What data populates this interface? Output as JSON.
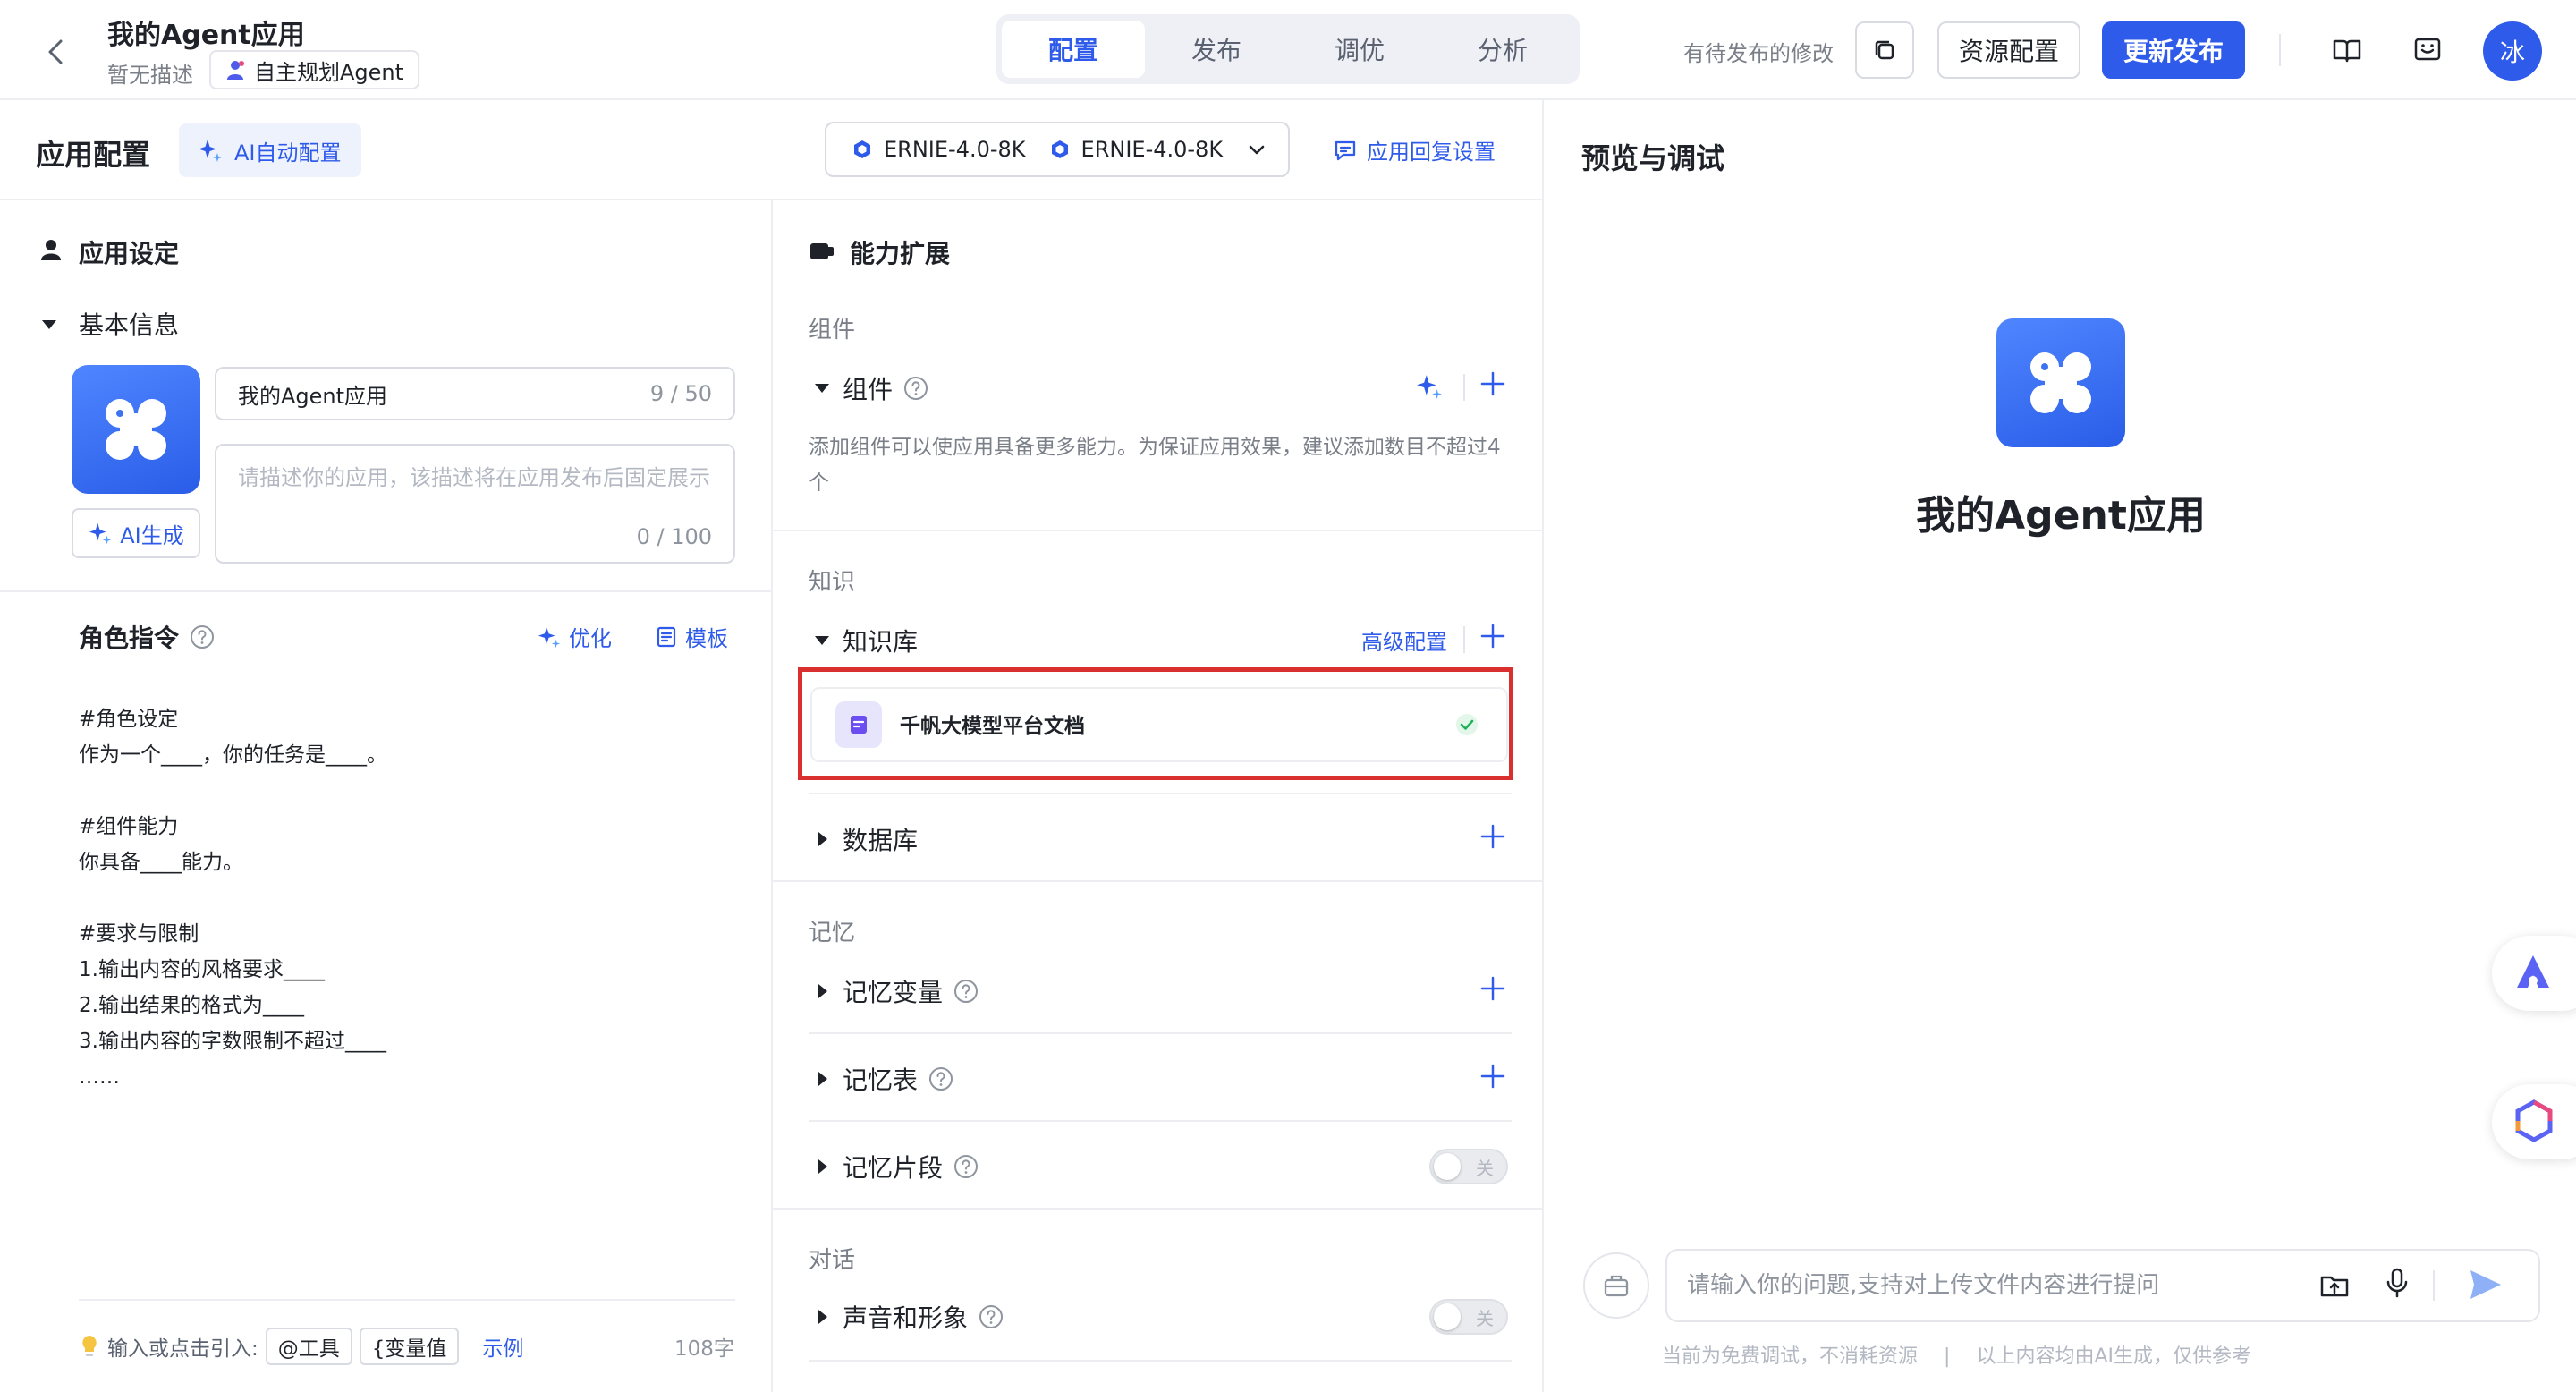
{
  "header": {
    "title": "我的Agent应用",
    "description": "暂无描述",
    "agent_type": "自主规划Agent",
    "tabs": [
      {
        "label": "配置",
        "active": true
      },
      {
        "label": "发布",
        "active": false
      },
      {
        "label": "调优",
        "active": false
      },
      {
        "label": "分析",
        "active": false
      }
    ],
    "pending_changes": "有待发布的修改",
    "resource_button": "资源配置",
    "publish_button": "更新发布",
    "avatar": "冰"
  },
  "config": {
    "title": "应用配置",
    "ai_config": "AI自动配置",
    "models": [
      "ERNIE-4.0-8K",
      "ERNIE-4.0-8K"
    ],
    "reply_settings": "应用回复设置"
  },
  "settings": {
    "title": "应用设定",
    "basic_info": "基本信息",
    "ai_generate": "AI生成",
    "name_value": "我的Agent应用",
    "name_count": "9 / 50",
    "desc_placeholder": "请描述你的应用，该描述将在应用发布后固定展示",
    "desc_count": "0 / 100",
    "role_title": "角色指令",
    "optimize": "优化",
    "template": "模板",
    "prompt_lines": [
      "#角色设定",
      "作为一个____，你的任务是____。",
      "",
      "#组件能力",
      "你具备____能力。",
      "",
      "#要求与限制",
      "1.输出内容的风格要求____",
      "2.输出结果的格式为____",
      "3.输出内容的字数限制不超过____",
      "……"
    ],
    "hint": "输入或点击引入:",
    "chip_tool": "@工具",
    "chip_var": "{变量值",
    "example": "示例",
    "word_count": "108字"
  },
  "extensions": {
    "title": "能力扩展",
    "components_group": "组件",
    "components_title": "组件",
    "components_desc": "添加组件可以使应用具备更多能力。为保证应用效果，建议添加数目不超过4个",
    "knowledge_group": "知识",
    "kb_title": "知识库",
    "advanced_config": "高级配置",
    "kb_item": "千帆大模型平台文档",
    "database_title": "数据库",
    "memory_group": "记忆",
    "memory_variables": "记忆变量",
    "memory_table": "记忆表",
    "memory_fragments": "记忆片段",
    "toggle_off": "关",
    "dialog_group": "对话",
    "voice_avatar": "声音和形象"
  },
  "preview": {
    "title": "预览与调试",
    "app_name": "我的Agent应用",
    "input_placeholder": "请输入你的问题,支持对上传文件内容进行提问",
    "note_left": "当前为免费调试，不消耗资源",
    "note_sep": "|",
    "note_right": "以上内容均由AI生成，仅供参考"
  },
  "colors": {
    "accent": "#2f5bea",
    "highlight": "#d92f2f",
    "success": "#20b25a"
  }
}
